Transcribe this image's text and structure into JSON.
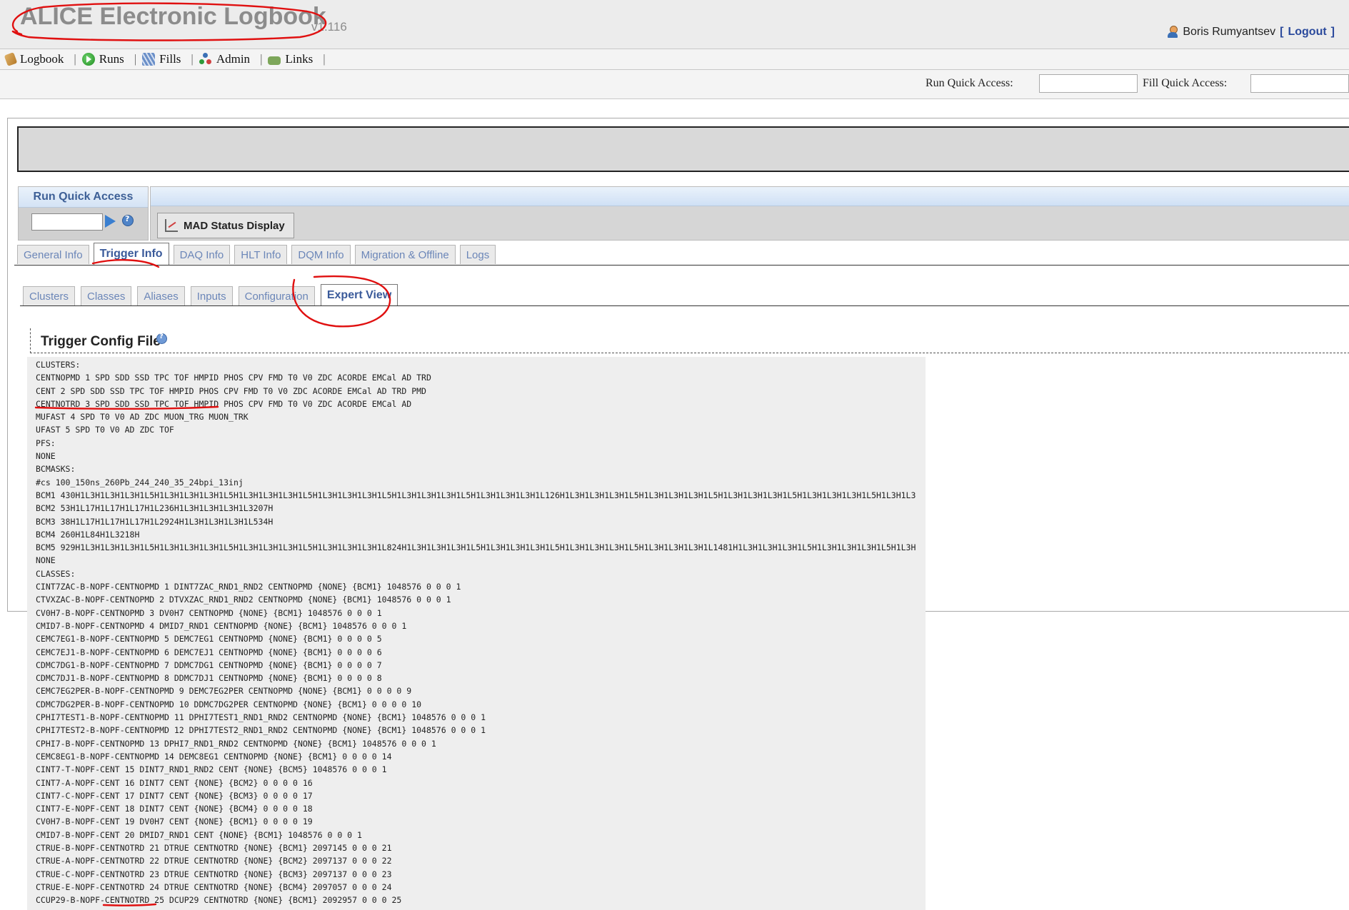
{
  "header": {
    "app_title": "ALICE Electronic Logbook",
    "version": "v1.116",
    "user_name": "Boris Rumyantsev",
    "logout_label": "Logout"
  },
  "nav": {
    "items": [
      {
        "label": "Logbook",
        "icon": "logbook-icon"
      },
      {
        "label": "Runs",
        "icon": "runs-icon"
      },
      {
        "label": "Fills",
        "icon": "fills-icon"
      },
      {
        "label": "Admin",
        "icon": "admin-icon"
      },
      {
        "label": "Links",
        "icon": "links-icon"
      }
    ],
    "separator": "|"
  },
  "quick_access": {
    "run_label": "Run Quick Access:",
    "run_value": "",
    "fill_label": "Fill Quick Access:",
    "fill_value": ""
  },
  "run_quick_access_box": {
    "title": "Run Quick Access",
    "value": ""
  },
  "mad_button": {
    "label": "MAD Status Display"
  },
  "main_tabs": [
    {
      "label": "General Info",
      "active": false
    },
    {
      "label": "Trigger Info",
      "active": true
    },
    {
      "label": "DAQ Info",
      "active": false
    },
    {
      "label": "HLT Info",
      "active": false
    },
    {
      "label": "DQM Info",
      "active": false
    },
    {
      "label": "Migration & Offline",
      "active": false
    },
    {
      "label": "Logs",
      "active": false
    }
  ],
  "sub_tabs": [
    {
      "label": "Clusters",
      "active": false
    },
    {
      "label": "Classes",
      "active": false
    },
    {
      "label": "Aliases",
      "active": false
    },
    {
      "label": "Inputs",
      "active": false
    },
    {
      "label": "Configuration",
      "active": false
    },
    {
      "label": "Expert View",
      "active": true
    }
  ],
  "config": {
    "title": "Trigger Config File",
    "lines": [
      "CLUSTERS:",
      "CENTNOPMD 1 SPD SDD SSD TPC TOF HMPID PHOS CPV FMD T0 V0 ZDC ACORDE EMCal AD TRD",
      "CENT 2 SPD SDD SSD TPC TOF HMPID PHOS CPV FMD T0 V0 ZDC ACORDE EMCal AD TRD PMD",
      "CENTNOTRD 3 SPD SDD SSD TPC TOF HMPID PHOS CPV FMD T0 V0 ZDC ACORDE EMCal AD",
      "MUFAST 4 SPD T0 V0 AD ZDC MUON_TRG MUON_TRK",
      "UFAST 5 SPD T0 V0 AD ZDC TOF",
      "PFS:",
      "NONE",
      "BCMASKS:",
      "#cs 100_150ns_260Pb_244_240_35_24bpi_13inj",
      "BCM1 430H1L3H1L3H1L3H1L5H1L3H1L3H1L3H1L5H1L3H1L3H1L3H1L5H1L3H1L3H1L3H1L5H1L3H1L3H1L3H1L5H1L3H1L3H1L3H1L126H1L3H1L3H1L3H1L5H1L3H1L3H1L3H1L5H1L3H1L3H1L3H1L5H1L3H1L3H1L3H1L5H1L3H1L3",
      "BCM2 53H1L17H1L17H1L17H1L236H1L3H1L3H1L3H1L3207H",
      "BCM3 38H1L17H1L17H1L17H1L2924H1L3H1L3H1L3H1L534H",
      "BCM4 260H1L84H1L3218H",
      "BCM5 929H1L3H1L3H1L3H1L5H1L3H1L3H1L3H1L5H1L3H1L3H1L3H1L5H1L3H1L3H1L3H1L824H1L3H1L3H1L3H1L5H1L3H1L3H1L3H1L5H1L3H1L3H1L3H1L5H1L3H1L3H1L3H1L1481H1L3H1L3H1L3H1L5H1L3H1L3H1L3H1L5H1L3H",
      "NONE",
      "CLASSES:",
      "CINT7ZAC-B-NOPF-CENTNOPMD 1 DINT7ZAC_RND1_RND2 CENTNOPMD {NONE} {BCM1} 1048576 0 0 0 1",
      "CTVXZAC-B-NOPF-CENTNOPMD 2 DTVXZAC_RND1_RND2 CENTNOPMD {NONE} {BCM1} 1048576 0 0 0 1",
      "CV0H7-B-NOPF-CENTNOPMD 3 DV0H7 CENTNOPMD {NONE} {BCM1} 1048576 0 0 0 1",
      "CMID7-B-NOPF-CENTNOPMD 4 DMID7_RND1 CENTNOPMD {NONE} {BCM1} 1048576 0 0 0 1",
      "CEMC7EG1-B-NOPF-CENTNOPMD 5 DEMC7EG1 CENTNOPMD {NONE} {BCM1} 0 0 0 0 5",
      "CEMC7EJ1-B-NOPF-CENTNOPMD 6 DEMC7EJ1 CENTNOPMD {NONE} {BCM1} 0 0 0 0 6",
      "CDMC7DG1-B-NOPF-CENTNOPMD 7 DDMC7DG1 CENTNOPMD {NONE} {BCM1} 0 0 0 0 7",
      "CDMC7DJ1-B-NOPF-CENTNOPMD 8 DDMC7DJ1 CENTNOPMD {NONE} {BCM1} 0 0 0 0 8",
      "CEMC7EG2PER-B-NOPF-CENTNOPMD 9 DEMC7EG2PER CENTNOPMD {NONE} {BCM1} 0 0 0 0 9",
      "CDMC7DG2PER-B-NOPF-CENTNOPMD 10 DDMC7DG2PER CENTNOPMD {NONE} {BCM1} 0 0 0 0 10",
      "CPHI7TEST1-B-NOPF-CENTNOPMD 11 DPHI7TEST1_RND1_RND2 CENTNOPMD {NONE} {BCM1} 1048576 0 0 0 1",
      "CPHI7TEST2-B-NOPF-CENTNOPMD 12 DPHI7TEST2_RND1_RND2 CENTNOPMD {NONE} {BCM1} 1048576 0 0 0 1",
      "CPHI7-B-NOPF-CENTNOPMD 13 DPHI7_RND1_RND2 CENTNOPMD {NONE} {BCM1} 1048576 0 0 0 1",
      "CEMC8EG1-B-NOPF-CENTNOPMD 14 DEMC8EG1 CENTNOPMD {NONE} {BCM1} 0 0 0 0 14",
      "CINT7-T-NOPF-CENT 15 DINT7_RND1_RND2 CENT {NONE} {BCM5} 1048576 0 0 0 1",
      "CINT7-A-NOPF-CENT 16 DINT7 CENT {NONE} {BCM2} 0 0 0 0 16",
      "CINT7-C-NOPF-CENT 17 DINT7 CENT {NONE} {BCM3} 0 0 0 0 17",
      "CINT7-E-NOPF-CENT 18 DINT7 CENT {NONE} {BCM4} 0 0 0 0 18",
      "CV0H7-B-NOPF-CENT 19 DV0H7 CENT {NONE} {BCM1} 0 0 0 0 19",
      "CMID7-B-NOPF-CENT 20 DMID7_RND1 CENT {NONE} {BCM1} 1048576 0 0 0 1",
      "CTRUE-B-NOPF-CENTNOTRD 21 DTRUE CENTNOTRD {NONE} {BCM1} 2097145 0 0 0 21",
      "CTRUE-A-NOPF-CENTNOTRD 22 DTRUE CENTNOTRD {NONE} {BCM2} 2097137 0 0 0 22",
      "CTRUE-C-NOPF-CENTNOTRD 23 DTRUE CENTNOTRD {NONE} {BCM3} 2097137 0 0 0 23",
      "CTRUE-E-NOPF-CENTNOTRD 24 DTRUE CENTNOTRD {NONE} {BCM4} 2097057 0 0 0 24",
      "CCUP29-B-NOPF-CENTNOTRD 25 DCUP29 CENTNOTRD {NONE} {BCM1} 2092957 0 0 0 25"
    ]
  },
  "colors": {
    "accent_blue": "#3a5a9a",
    "annotation_red": "#e01010"
  }
}
